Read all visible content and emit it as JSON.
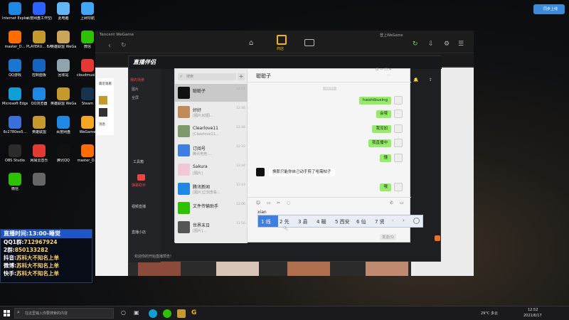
{
  "desktop": {
    "icons": [
      {
        "label": "Internet Explorer",
        "color": "#1e88e5"
      },
      {
        "label": "百度网盘工作空间",
        "color": "#2962ff"
      },
      {
        "label": "此电脑",
        "color": "#64b5f6"
      },
      {
        "label": "上网导航",
        "color": "#42a5f5"
      },
      {
        "label": "master_D...",
        "color": "#ff6d00"
      },
      {
        "label": "PLAYERU... BATTLEGR...",
        "color": "#c49a2c"
      },
      {
        "label": "英雄联盟 WeGame版",
        "color": "#caa55a"
      },
      {
        "label": "微信",
        "color": "#2dc100"
      },
      {
        "label": "QQ游戏",
        "color": "#1976d2"
      },
      {
        "label": "控制面板",
        "color": "#1565c0"
      },
      {
        "label": "回收站",
        "color": "#90a4ae"
      },
      {
        "label": "cloudmusi...",
        "color": "#e53935"
      },
      {
        "label": "Microsoft Edge",
        "color": "#0f9ed5"
      },
      {
        "label": "QQ浏览器",
        "color": "#1e88e5"
      },
      {
        "label": "英雄联盟 WeGame版",
        "color": "#c49a2c"
      },
      {
        "label": "Steam",
        "color": "#17324f"
      },
      {
        "label": "6c2780ee5...",
        "color": "#3b6fd9"
      },
      {
        "label": "英雄联盟",
        "color": "#c49a2c"
      },
      {
        "label": "百度网盘",
        "color": "#1e88e5"
      },
      {
        "label": "WeGame",
        "color": "#f5a623"
      },
      {
        "label": "OBS Studio",
        "color": "#2b2b2b"
      },
      {
        "label": "网易云音乐",
        "color": "#e53935"
      },
      {
        "label": "腾讯QQ",
        "color": "#111"
      },
      {
        "label": "master_D...",
        "color": "#ff6d00"
      },
      {
        "label": "微信",
        "color": "#2dc100"
      },
      {
        "label": "",
        "color": "#666"
      }
    ],
    "qq_badge": "同步上线"
  },
  "overlay": {
    "header": "直播时间:13:00-睡觉",
    "lines": [
      {
        "k": "QQ1群:",
        "v": "712967924"
      },
      {
        "k": "2群:",
        "v": "850133282"
      },
      {
        "k": "抖音:",
        "v": "苏科大不知名上单"
      },
      {
        "k": "微博:",
        "v": "苏科大不知名上单"
      },
      {
        "k": "快手:",
        "v": "苏科大不知名上单"
      }
    ]
  },
  "wegame": {
    "brand": "Tencent WeGame",
    "store_label": "商店",
    "user": "登上WeGame"
  },
  "livetool": {
    "title": "直播伴侣",
    "tabs": [
      "我的场景",
      "其他"
    ],
    "scene1": "图片",
    "scene2": "全屏",
    "side": [
      "工具箱",
      "弹幕助手",
      "视频直播",
      "直播小店",
      "直播任务"
    ],
    "notice": "欢迎你的开始直播预告!",
    "right_labels": [
      "最近观看",
      "消息"
    ]
  },
  "chat": {
    "search_placeholder": "搜索",
    "title": "聪聪子",
    "contacts": [
      {
        "name": "聪聪子",
        "snippet": "",
        "time": "12:51",
        "color": "#111"
      },
      {
        "name": "好好",
        "snippet": "[图片]动图...",
        "time": "12:46",
        "color": "#c08a5a"
      },
      {
        "name": "Clearlove11",
        "snippet": "[Clearlove11...",
        "time": "12:46",
        "color": "#7f9a6a"
      },
      {
        "name": "订阅号",
        "snippet": "腾讯电竞:...",
        "time": "12:33",
        "color": "#3d7ee0"
      },
      {
        "name": "Sakura",
        "snippet": "[图片]",
        "time": "12:34",
        "color": "#f0c8d8"
      },
      {
        "name": "腾讯新闻",
        "snippet": "[图片]立刻查看...",
        "time": "12:19",
        "color": "#1e88e5"
      },
      {
        "name": "文件传输助手",
        "snippet": "",
        "time": "12:06",
        "color": "#2dc100"
      },
      {
        "name": "世界末日",
        "snippet": "[图片]...",
        "time": "11:56",
        "color": "#555"
      }
    ],
    "timestamp": "12:51",
    "messages": [
      {
        "who": "me",
        "text": "haishibuxing"
      },
      {
        "who": "me",
        "text": "会哦"
      },
      {
        "who": "me",
        "text": "我没加"
      },
      {
        "who": "me",
        "text": "我直播中"
      },
      {
        "who": "me",
        "text": "懂"
      },
      {
        "who": "other",
        "text": "换那只能你自己动手剪了哈需帖子"
      },
      {
        "who": "me",
        "text": "哦"
      }
    ],
    "input_text": "xian",
    "send": "发送(S)"
  },
  "ime": {
    "candidates": [
      "1 线",
      "2 先",
      "3 县",
      "4 暖",
      "5 西安",
      "6 仙",
      "7 贤"
    ]
  },
  "taskbar": {
    "search_placeholder": "在这里输入你要搜索的内容",
    "weather": "29°C 多云",
    "time": "12:52",
    "date": "2021/6/17"
  }
}
